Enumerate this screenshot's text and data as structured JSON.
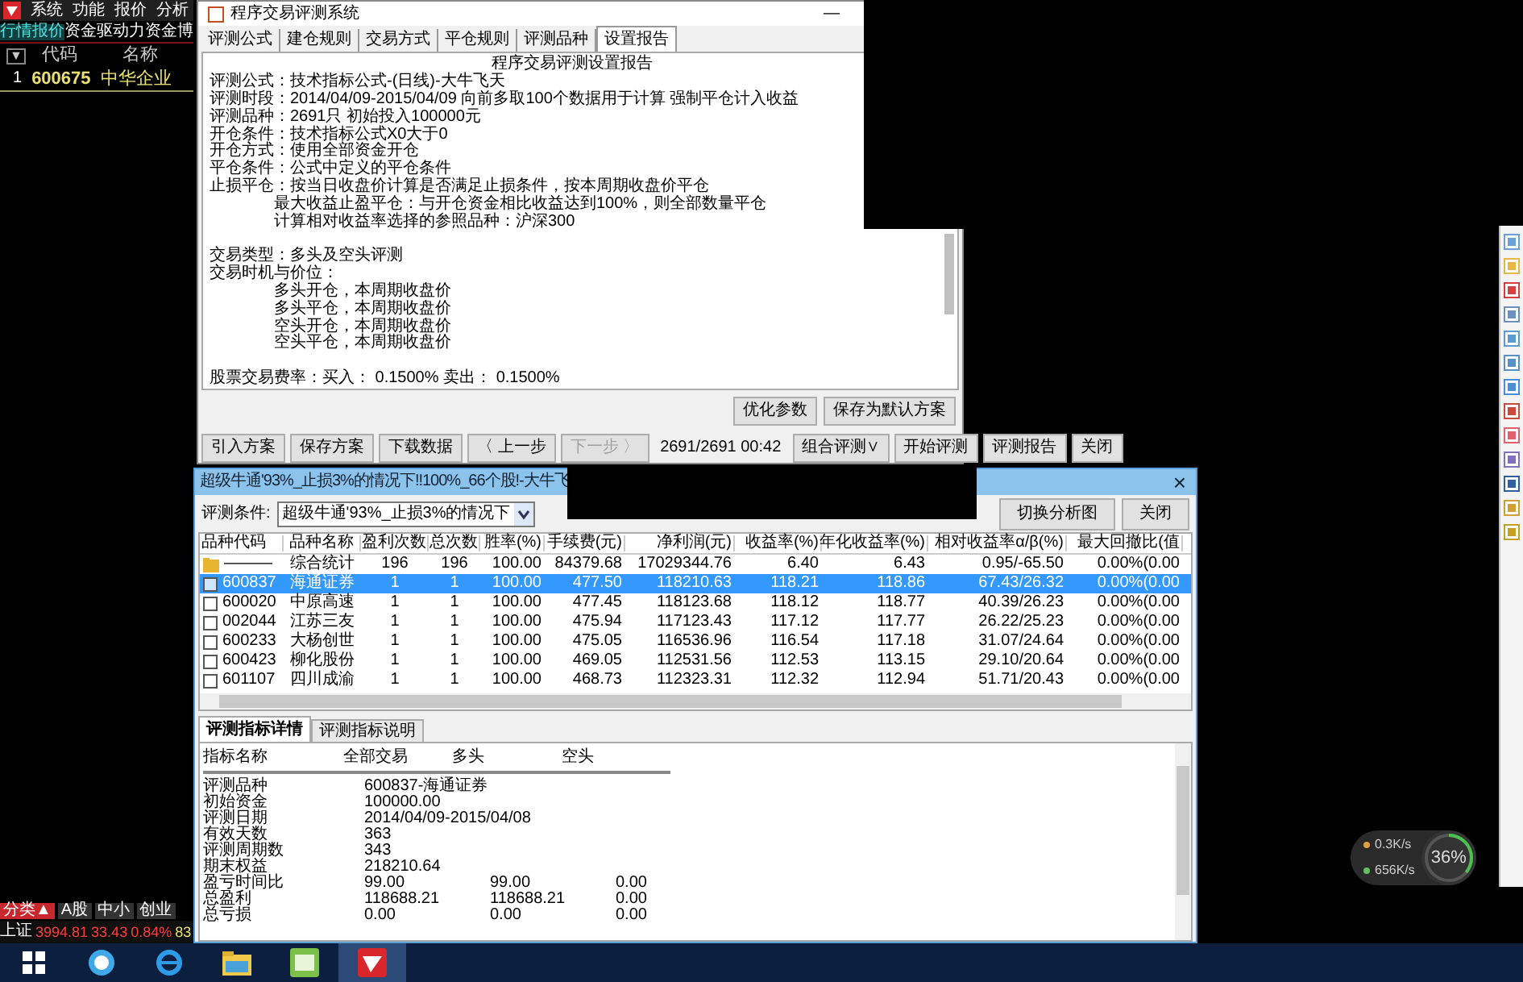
{
  "stock_app": {
    "menu": [
      "系统",
      "功能",
      "报价",
      "分析"
    ],
    "tabs": [
      {
        "label": "行情报价",
        "selected": true
      },
      {
        "label": "资金驱动力",
        "selected": false
      },
      {
        "label": "资金博",
        "selected": false
      }
    ],
    "header": {
      "toggle": "▼",
      "columns": [
        "代码",
        "名称"
      ]
    },
    "rows": [
      {
        "index": "1",
        "code": "600675",
        "name": "中华企业"
      }
    ],
    "bottom_tabs": [
      {
        "label": "分类▲",
        "selected": true
      },
      {
        "label": "A股",
        "selected": false
      },
      {
        "label": "中小",
        "selected": false
      },
      {
        "label": "创业",
        "selected": false
      }
    ],
    "index_bar": {
      "name": "上证",
      "value": "3994.81",
      "change": "33.43",
      "percent": "0.84%",
      "extra": "83"
    }
  },
  "setup_window": {
    "title": "程序交易评测系统",
    "minimize": "—",
    "tabs": [
      {
        "label": "评测公式",
        "selected": false
      },
      {
        "label": "建仓规则",
        "selected": false
      },
      {
        "label": "交易方式",
        "selected": false
      },
      {
        "label": "平仓规则",
        "selected": false
      },
      {
        "label": "评测品种",
        "selected": false
      },
      {
        "label": "设置报告",
        "selected": true
      }
    ],
    "report_title": "程序交易评测设置报告",
    "sections": [
      [
        {
          "text": "评测公式：技术指标公式-(日线)-大牛飞天"
        },
        {
          "text": "评测时段：2014/04/09-2015/04/09 向前多取100个数据用于计算 强制平仓计入收益"
        },
        {
          "text": "评测品种：2691只 初始投入100000元"
        },
        {
          "text": "开仓条件：技术指标公式X0大于0"
        },
        {
          "text": "开仓方式：使用全部资金开仓"
        },
        {
          "text": "平仓条件：公式中定义的平仓条件"
        },
        {
          "text": "止损平仓：按当日收盘价计算是否满足止损条件，按本周期收盘价平仓",
          "children": [
            {
              "text": "最大收益止盈平仓：与开仓资金相比收益达到100%，则全部数量平仓"
            },
            {
              "text": "计算相对收益率选择的参照品种：沪深300"
            }
          ]
        }
      ],
      [
        {
          "text": "交易类型：多头及空头评测"
        },
        {
          "text": "交易时机与价位：",
          "children": [
            {
              "text": "多头开仓，本周期收盘价"
            },
            {
              "text": "多头平仓，本周期收盘价"
            },
            {
              "text": "空头开仓，本周期收盘价"
            },
            {
              "text": "空头平仓，本周期收盘价"
            }
          ]
        }
      ],
      [
        {
          "text": "股票交易费率：买入： 0.1500%  卖出： 0.1500%"
        }
      ]
    ],
    "side_buttons": [
      "优化参数",
      "保存为默认方案"
    ],
    "buttons": [
      {
        "kind": "button",
        "label": "引入方案",
        "disabled": false
      },
      {
        "kind": "button",
        "label": "保存方案",
        "disabled": false
      },
      {
        "kind": "button",
        "label": "下载数据",
        "disabled": false
      },
      {
        "kind": "button",
        "label": "〈 上一步",
        "disabled": false
      },
      {
        "kind": "button",
        "label": "下一步 〉",
        "disabled": true
      },
      {
        "kind": "text",
        "label": "2691/2691 00:42"
      },
      {
        "kind": "button",
        "label": "组合评测∨",
        "disabled": false
      },
      {
        "kind": "button",
        "label": "开始评测",
        "disabled": false
      },
      {
        "kind": "button",
        "label": "评测报告",
        "disabled": false
      },
      {
        "kind": "button",
        "label": "关闭",
        "disabled": false
      }
    ]
  },
  "result_window": {
    "title": "超级牛通'93%_止损3%的情况下!!100%_66个股!-大牛飞",
    "close": "×",
    "condition_label": "评测条件:",
    "condition_value": "超级牛通'93%_止损3%的情况下",
    "buttons": [
      "切换分析图",
      "关闭"
    ],
    "columns": [
      "品种代码",
      "品种名称",
      "盈利次数",
      "总次数",
      "胜率(%)",
      "手续费(元)",
      "净利润(元)",
      "收益率(%)",
      "年化收益率(%)",
      "相对收益率α/β(%)",
      "最大回撤比(值"
    ],
    "rows": [
      {
        "kind": "summary",
        "selected": false,
        "cells": [
          "———",
          "综合统计",
          "196",
          "196",
          "100.00",
          "84379.68",
          "17029344.76",
          "6.40",
          "6.43",
          "0.95/-65.50",
          "0.00%(0.00"
        ]
      },
      {
        "kind": "item",
        "selected": true,
        "cells": [
          "600837",
          "海通证券",
          "1",
          "1",
          "100.00",
          "477.50",
          "118210.63",
          "118.21",
          "118.86",
          "67.43/26.32",
          "0.00%(0.00"
        ]
      },
      {
        "kind": "item",
        "selected": false,
        "cells": [
          "600020",
          "中原高速",
          "1",
          "1",
          "100.00",
          "477.45",
          "118123.68",
          "118.12",
          "118.77",
          "40.39/26.23",
          "0.00%(0.00"
        ]
      },
      {
        "kind": "item",
        "selected": false,
        "cells": [
          "002044",
          "江苏三友",
          "1",
          "1",
          "100.00",
          "475.94",
          "117123.43",
          "117.12",
          "117.77",
          "26.22/25.23",
          "0.00%(0.00"
        ]
      },
      {
        "kind": "item",
        "selected": false,
        "cells": [
          "600233",
          "大杨创世",
          "1",
          "1",
          "100.00",
          "475.05",
          "116536.96",
          "116.54",
          "117.18",
          "31.07/24.64",
          "0.00%(0.00"
        ]
      },
      {
        "kind": "item",
        "selected": false,
        "cells": [
          "600423",
          "柳化股份",
          "1",
          "1",
          "100.00",
          "469.05",
          "112531.56",
          "112.53",
          "113.15",
          "29.10/20.64",
          "0.00%(0.00"
        ]
      },
      {
        "kind": "item",
        "selected": false,
        "cells": [
          "601107",
          "四川成渝",
          "1",
          "1",
          "100.00",
          "468.73",
          "112323.31",
          "112.32",
          "112.94",
          "51.71/20.43",
          "0.00%(0.00"
        ]
      }
    ],
    "detail_tabs": [
      {
        "label": "评测指标详情",
        "selected": true
      },
      {
        "label": "评测指标说明",
        "selected": false
      }
    ],
    "detail_columns": [
      "指标名称",
      "全部交易",
      "多头",
      "空头"
    ],
    "detail_rows": [
      [
        "评测品种",
        "600837-海通证券"
      ],
      [
        "初始资金",
        "100000.00"
      ],
      [
        "评测日期",
        "2014/04/09-2015/04/08"
      ],
      [
        "有效天数",
        "363"
      ],
      [
        "评测周期数",
        "343"
      ],
      [
        "期末权益",
        "218210.64"
      ],
      [
        "盈亏时间比",
        "99.00",
        "99.00",
        "0.00"
      ],
      [
        "总盈利",
        "118688.21",
        "118688.21",
        "0.00"
      ],
      [
        "总亏损",
        "0.00",
        "0.00",
        "0.00"
      ]
    ]
  },
  "network_widget": {
    "upload": "0.3K/s",
    "download": "656K/s",
    "percent": "36%",
    "level": 0.36
  },
  "taskbar": [
    {
      "kind": "start",
      "selected": false
    },
    {
      "kind": "circle_k",
      "selected": false
    },
    {
      "kind": "browser",
      "selected": false
    },
    {
      "kind": "folder",
      "selected": false
    },
    {
      "kind": "green_app",
      "selected": false
    },
    {
      "kind": "red_app",
      "selected": true
    }
  ]
}
